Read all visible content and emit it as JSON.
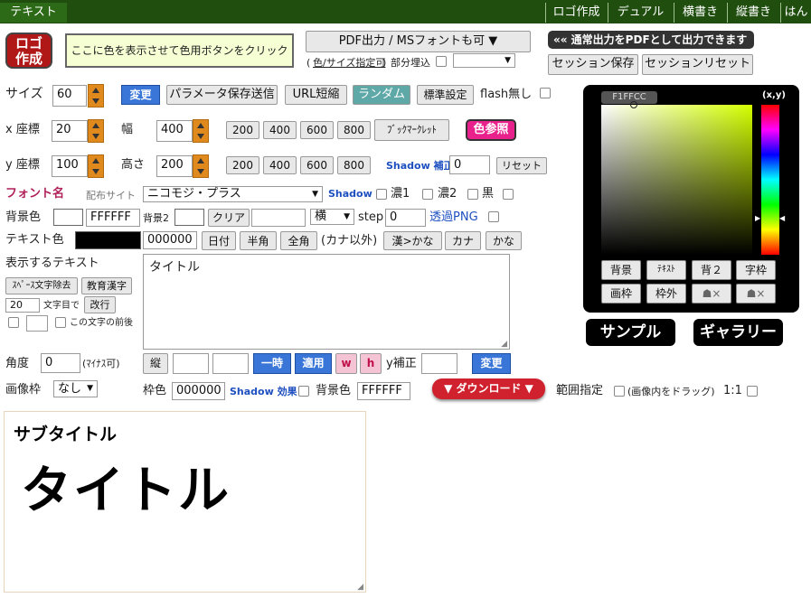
{
  "nav": {
    "left_tab": "テキスト",
    "tabs": [
      "ロゴ作成",
      "デュアル",
      "横書き",
      "縦書き",
      "はん"
    ]
  },
  "logo_badge": [
    "ロゴ",
    "作成"
  ],
  "color_hint": "ここに色を表示させて色用ボタンをクリック",
  "pdf": {
    "button": "PDF出力 / MSフォントも可 ▼",
    "size_link": "色/サイズ指定可",
    "partial_embed": "部分埋込",
    "notice": "«« 通常出力をPDFとして出力できます",
    "save_session": "セッション保存",
    "reset_session": "セッションリセット"
  },
  "row1": {
    "size_label": "サイズ",
    "size_value": "60",
    "change": "変更",
    "param_send": "パラメータ保存送信",
    "url_short": "URL短縮",
    "random": "ランダム",
    "standard": "標準設定",
    "flash_none": "flash無し"
  },
  "row2": {
    "x_label": "x 座標",
    "x_value": "20",
    "w_label": "幅",
    "w_value": "400",
    "presets": [
      "200",
      "400",
      "600",
      "800"
    ],
    "bookmarklet": "ﾌﾞｯｸﾏｰｸﾚｯﾄ",
    "color_ref": "色参照"
  },
  "row3": {
    "y_label": "y 座標",
    "y_value": "100",
    "h_label": "高さ",
    "h_value": "200",
    "presets": [
      "200",
      "400",
      "600",
      "800"
    ],
    "shadow_fix": "Shadow 補正",
    "shadow_value": "0",
    "reset": "リセット"
  },
  "font_row": {
    "label": "フォント名",
    "site": "配布サイト",
    "font": "ニコモジ・プラス",
    "shadow": "Shadow",
    "dark1": "濃1",
    "dark2": "濃2",
    "black": "黒"
  },
  "bg_row": {
    "label": "背景色",
    "value": "FFFFFF",
    "bg2": "背景2",
    "clear": "クリア",
    "direction": "横",
    "step_label": "step",
    "step_value": "0",
    "transparent": "透過PNG"
  },
  "text_color_row": {
    "label": "テキスト色",
    "value": "000000",
    "date": "日付",
    "half": "半角",
    "full": "全角",
    "kana_except": "(カナ以外)",
    "kan_kana": "漢>かな",
    "kana": "カナ",
    "kana2": "かな"
  },
  "text_area": {
    "label": "表示するテキスト",
    "remove_space": "ｽﾍﾟｰｽ文字除去",
    "edu_kanji": "教育漢字",
    "num_value": "20",
    "num_suffix": "文字目で",
    "newline": "改行",
    "before_char": "この文字の前後",
    "content": "タイトル"
  },
  "angle_row": {
    "label": "角度",
    "value": "0",
    "minus_ok": "(ﾏｲﾅｽ可)",
    "vertical": "縦",
    "temp": "一時",
    "apply": "適用",
    "w": "w",
    "h": "h",
    "y_fix": "y補正",
    "change": "変更"
  },
  "frame_row": {
    "label": "画像枠",
    "value": "なし",
    "border_label": "枠色",
    "border_value": "000000",
    "shadow_effect": "Shadow 効果",
    "bg_label": "背景色",
    "bg_value": "FFFFFF",
    "download": "▼ ダウンロード ▼",
    "range": "範囲指定",
    "drag_note": "(画像内をドラッグ)",
    "ratio": "1:1"
  },
  "picker": {
    "hex": "F1FFCC",
    "xy": "(x,y)",
    "hue_color": "#d4ff00",
    "buttons_row1": [
      "背景",
      "ﾃｷｽﾄ",
      "背２",
      "字枠"
    ],
    "buttons_row2": [
      "画枠",
      "枠外",
      "☗×",
      "☗×"
    ]
  },
  "sample_label": "サンプル",
  "gallery_label": "ギャラリー",
  "preview": {
    "subtitle": "サブタイトル",
    "title": "タイトル"
  }
}
